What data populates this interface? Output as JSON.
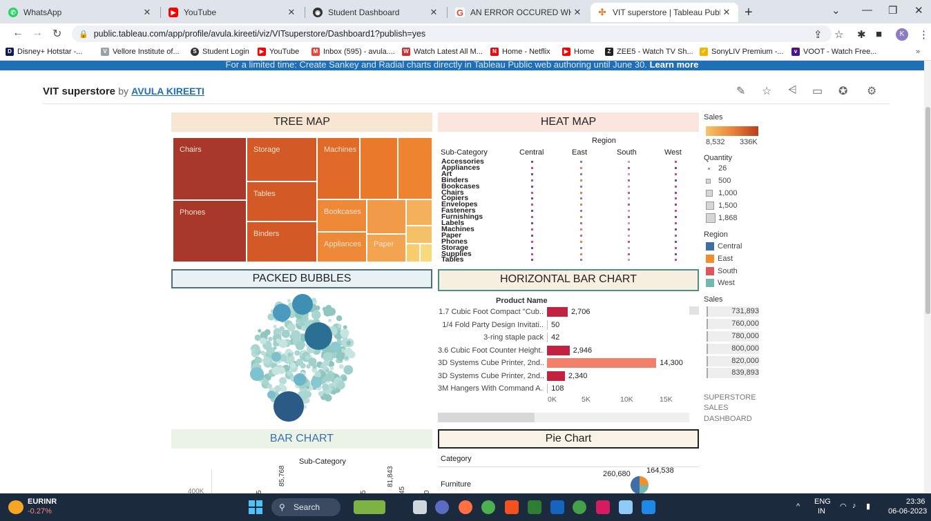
{
  "browser": {
    "tabs": [
      {
        "label": "WhatsApp",
        "icon": "whatsapp-icon",
        "color": "#25d366"
      },
      {
        "label": "YouTube",
        "icon": "youtube-icon",
        "color": "#ff0000"
      },
      {
        "label": "Student Dashboard",
        "icon": "globe-icon",
        "color": "#333333"
      },
      {
        "label": "AN ERROR OCCURED WHILE ATT",
        "icon": "google-icon",
        "color": "#ea4335"
      },
      {
        "label": "VIT superstore | Tableau Public",
        "icon": "tableau-icon",
        "color": "#e97627"
      }
    ],
    "url": "public.tableau.com/app/profile/avula.kireeti/viz/VITsuperstore/Dashboard1?publish=yes",
    "profile_initial": "K",
    "bookmarks": [
      {
        "label": "Disney+ Hotstar -...",
        "color": "#0f1c4d",
        "glyph": "D"
      },
      {
        "label": "Vellore Institute of...",
        "color": "#9aa0a6",
        "glyph": "V"
      },
      {
        "label": "Student Login",
        "color": "#333333",
        "glyph": "S"
      },
      {
        "label": "YouTube",
        "color": "#ff0000",
        "glyph": "▶"
      },
      {
        "label": "Inbox (595) - avula....",
        "color": "#ea4335",
        "glyph": "M"
      },
      {
        "label": "Watch Latest All M...",
        "color": "#d32f2f",
        "glyph": "W"
      },
      {
        "label": "Home - Netflix",
        "color": "#e50914",
        "glyph": "N"
      },
      {
        "label": "Home",
        "color": "#ff0000",
        "glyph": "▶"
      },
      {
        "label": "ZEE5 - Watch TV Sh...",
        "color": "#222222",
        "glyph": "Z"
      },
      {
        "label": "SonyLIV Premium -...",
        "color": "#f5b400",
        "glyph": "✓"
      },
      {
        "label": "VOOT - Watch Free...",
        "color": "#4a148c",
        "glyph": "v"
      }
    ]
  },
  "page": {
    "promo": "For a limited time: Create Sankey and Radial charts directly in Tableau Public web authoring until June 30.",
    "promo_link": "Learn more",
    "viz_title": "VIT superstore",
    "by": "by",
    "author": "AVULA KIREETI"
  },
  "panels": {
    "tree": "TREE MAP",
    "heat": "HEAT MAP",
    "bubbles": "PACKED BUBBLES",
    "hbar": "HORIZONTAL BAR CHART",
    "bar": "BAR CHART",
    "pie": "Pie Chart"
  },
  "treemap": [
    {
      "label": "Chairs",
      "color": "#a8382a"
    },
    {
      "label": "Phones",
      "color": "#a8382a"
    },
    {
      "label": "Storage",
      "color": "#d35a27"
    },
    {
      "label": "Tables",
      "color": "#d35a27"
    },
    {
      "label": "Binders",
      "color": "#d35a27"
    },
    {
      "label": "Machines",
      "color": "#e06a27"
    },
    {
      "label": "Bookcases",
      "color": "#ee8a37"
    },
    {
      "label": "Appliances",
      "color": "#ee8a37"
    },
    {
      "label": "Paper",
      "color": "#f3a451"
    }
  ],
  "heatmap": {
    "region_label": "Region",
    "row_header": "Sub-Category",
    "columns": [
      "Central",
      "East",
      "South",
      "West"
    ],
    "rows": [
      "Accessories",
      "Appliances",
      "Art",
      "Binders",
      "Bookcases",
      "Chairs",
      "Copiers",
      "Envelopes",
      "Fasteners",
      "Furnishings",
      "Labels",
      "Machines",
      "Paper",
      "Phones",
      "Storage",
      "Supplies",
      "Tables"
    ]
  },
  "legend": {
    "sales_title": "Sales",
    "sales_min": "8,532",
    "sales_max": "336K",
    "quantity_title": "Quantity",
    "quantity_items": [
      "26",
      "500",
      "1,000",
      "1,500",
      "1,868"
    ],
    "region_title": "Region",
    "regions": [
      {
        "name": "Central",
        "color": "#3e6ea5"
      },
      {
        "name": "East",
        "color": "#f28e2b"
      },
      {
        "name": "South",
        "color": "#e15759"
      },
      {
        "name": "West",
        "color": "#76b7b2"
      }
    ],
    "sales_filter_title": "Sales",
    "sales_filter": [
      "731,893",
      "760,000",
      "780,000",
      "800,000",
      "820,000",
      "839,893"
    ],
    "dashboard_label_1": "SUPERSTORE",
    "dashboard_label_2": "SALES",
    "dashboard_label_3": "DASHBOARD"
  },
  "hbar": {
    "header": "Product Name",
    "colors": {
      "low": "#c22140",
      "high": "#f0806a"
    }
  },
  "chart_data": [
    {
      "type": "bar",
      "orientation": "horizontal",
      "title": "HORIZONTAL BAR CHART",
      "ylabel": "Product Name",
      "categories": [
        "1.7 Cubic Foot Compact \"Cub..",
        "1/4 Fold Party Design Invitati..",
        "3-ring staple pack",
        "3.6 Cubic Foot Counter Height..",
        "3D Systems Cube Printer, 2nd..",
        "3D Systems Cube Printer, 2nd..",
        "3M Hangers With Command A.."
      ],
      "values": [
        2706,
        50,
        42,
        2946,
        14300,
        2340,
        108
      ],
      "value_labels": [
        "2,706",
        "50",
        "42",
        "2,946",
        "14,300",
        "2,340",
        "108"
      ],
      "xlim": [
        0,
        17000
      ],
      "xticks": [
        "0K",
        "5K",
        "10K",
        "15K"
      ]
    },
    {
      "type": "bar",
      "title": "BAR CHART",
      "xlabel": "Sub-Category",
      "yticks": [
        "400K"
      ],
      "partial_labels": [
        "5",
        "85,768",
        "5",
        "81,843",
        "45",
        "0"
      ]
    },
    {
      "type": "pie",
      "title": "Pie Chart",
      "category_label": "Category",
      "legend_row": "Furniture",
      "slice_labels": [
        "260,680",
        "164,538"
      ]
    }
  ],
  "taskbar": {
    "ticker_name": "EURINR",
    "ticker_change": "-0.27%",
    "search": "Search",
    "lang": "ENG",
    "region": "IN",
    "time": "23:36",
    "date": "06-06-2023"
  }
}
